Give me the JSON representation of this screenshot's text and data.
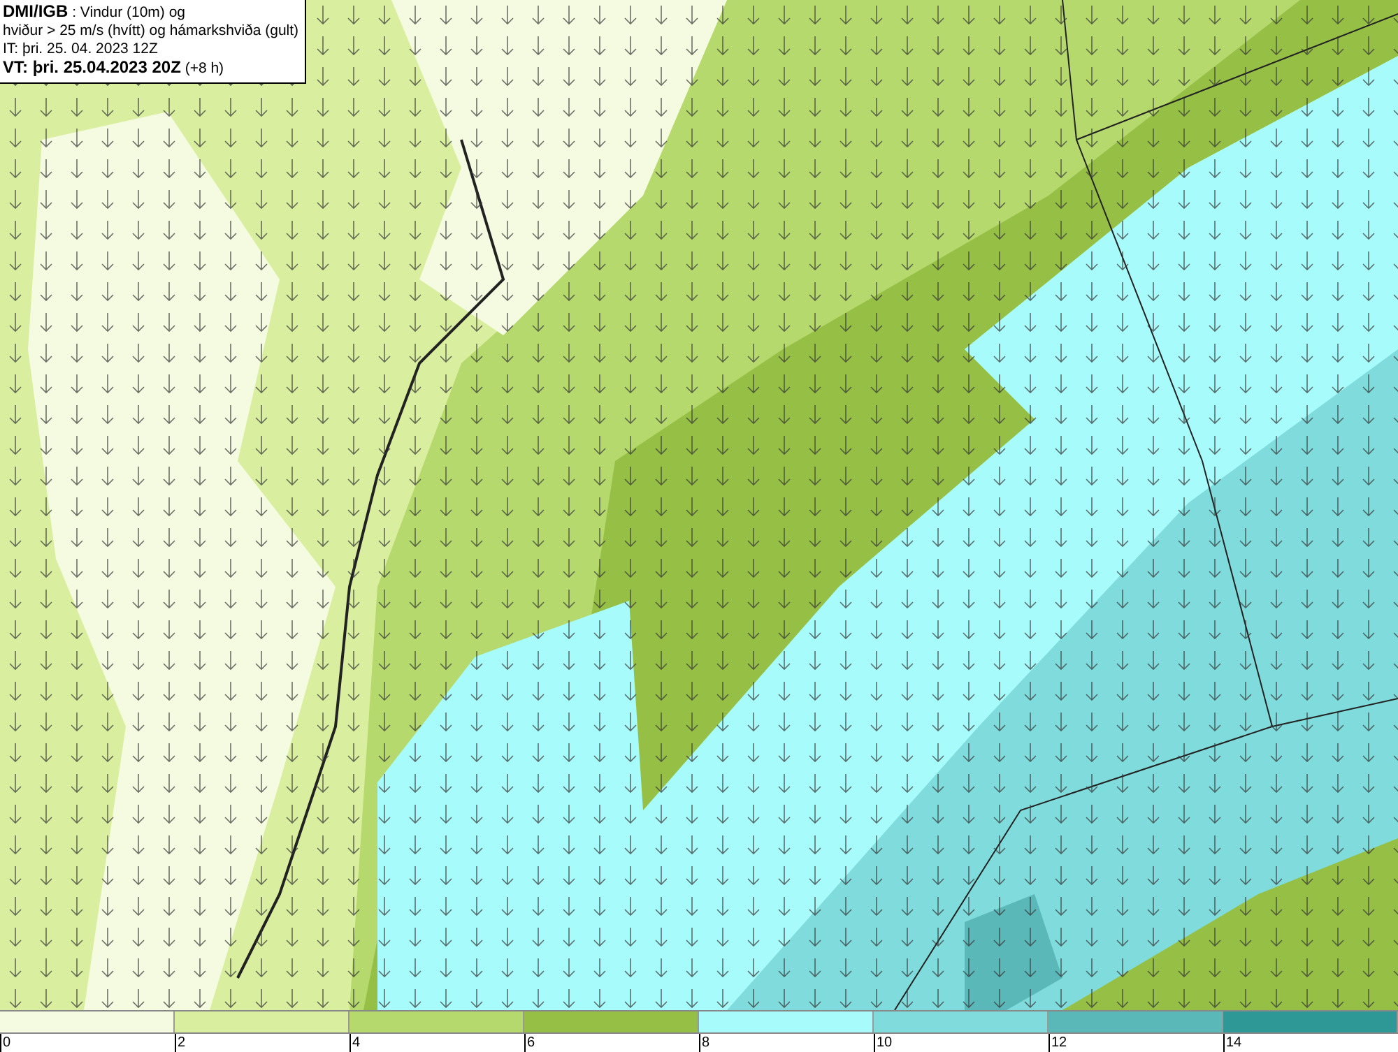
{
  "title_box": {
    "lines": [
      "**DMI/IGB** : Vindur (10m) og",
      "hviður > 25 m/s (hvítt) og hámarkshviða (gult)",
      "IT: þri. 25. 04. 2023 12Z",
      "**VT: þri. 25.04.2023 20Z** (+8 h)"
    ]
  },
  "legend": {
    "bins": [
      {
        "color": "#f5fbe0"
      },
      {
        "color": "#d9ef9f"
      },
      {
        "color": "#b5d96c"
      },
      {
        "color": "#96bf45"
      },
      {
        "color": "#a8fbfb"
      },
      {
        "color": "#80dcdc"
      },
      {
        "color": "#5bb8b8"
      },
      {
        "color": "#2e9896"
      }
    ],
    "ticks": [
      "0",
      "2",
      "4",
      "6",
      "8",
      "10",
      "12",
      "14"
    ]
  }
}
